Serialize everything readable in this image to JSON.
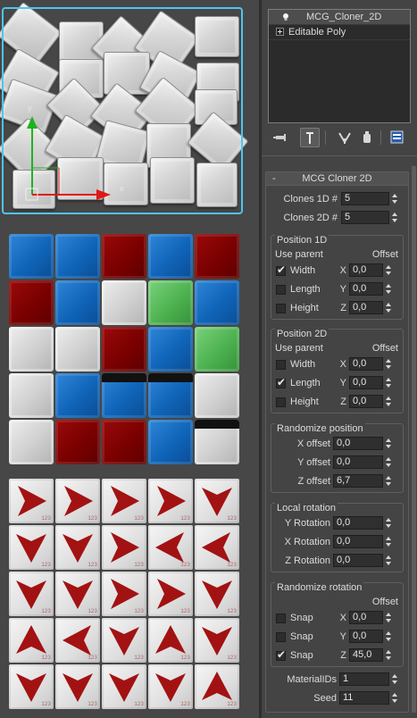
{
  "modifier_stack": {
    "items": [
      {
        "label": "MCG_Cloner_2D",
        "icon": "lightbulb-icon",
        "active": true
      },
      {
        "label": "Editable Poly",
        "icon": "expand-plus-icon",
        "active": false
      }
    ]
  },
  "stack_toolbar": {
    "buttons": [
      "pin-stack-icon",
      "show-end-result-icon",
      "make-unique-icon",
      "remove-modifier-icon",
      "configure-modifier-sets-icon"
    ]
  },
  "rollout": {
    "collapse_symbol": "-",
    "title": "MCG Cloner 2D",
    "clones_1d": {
      "label": "Clones 1D #",
      "value": "5"
    },
    "clones_2d": {
      "label": "Clones 2D #",
      "value": "5"
    },
    "position_1d": {
      "title": "Position 1D",
      "use_parent": "Use parent",
      "offset": "Offset",
      "rows": [
        {
          "label": "Width",
          "checked": true,
          "axis": "X",
          "value": "0,0"
        },
        {
          "label": "Length",
          "checked": false,
          "axis": "Y",
          "value": "0,0"
        },
        {
          "label": "Height",
          "checked": false,
          "axis": "Z",
          "value": "0,0"
        }
      ]
    },
    "position_2d": {
      "title": "Position 2D",
      "use_parent": "Use parent",
      "offset": "Offset",
      "rows": [
        {
          "label": "Width",
          "checked": false,
          "axis": "X",
          "value": "0,0"
        },
        {
          "label": "Length",
          "checked": true,
          "axis": "Y",
          "value": "0,0"
        },
        {
          "label": "Height",
          "checked": false,
          "axis": "Z",
          "value": "0,0"
        }
      ]
    },
    "randomize_position": {
      "title": "Randomize position",
      "rows": [
        {
          "label": "X offset",
          "value": "0,0"
        },
        {
          "label": "Y offset",
          "value": "0,0"
        },
        {
          "label": "Z offset",
          "value": "6,7"
        }
      ]
    },
    "local_rotation": {
      "title": "Local rotation",
      "rows": [
        {
          "label": "Y Rotation",
          "value": "0,0"
        },
        {
          "label": "X Rotation",
          "value": "0,0"
        },
        {
          "label": "Z Rotation",
          "value": "0,0"
        }
      ]
    },
    "randomize_rotation": {
      "title": "Randomize rotation",
      "offset": "Offset",
      "rows": [
        {
          "label": "Snap",
          "checked": false,
          "axis": "X",
          "value": "0,0"
        },
        {
          "label": "Snap",
          "checked": false,
          "axis": "Y",
          "value": "0,0"
        },
        {
          "label": "Snap",
          "checked": true,
          "axis": "Z",
          "value": "45,0"
        }
      ]
    },
    "material_ids": {
      "label": "MaterialIDs",
      "value": "1"
    },
    "seed": {
      "label": "Seed",
      "value": "11"
    }
  },
  "viewport": {
    "gizmo": {
      "x_label": "x",
      "y_label": "y",
      "x_color": "#e01818",
      "y_color": "#1fb21f",
      "z_color": "#1850e0"
    },
    "selection_color": "#4fc4f0",
    "arrow_tile_text": "123",
    "color_grid": [
      [
        "blue",
        "blue",
        "red",
        "blue",
        "red"
      ],
      [
        "red",
        "blue",
        "gray",
        "green",
        "blue"
      ],
      [
        "gray",
        "gray",
        "red",
        "blue",
        "green"
      ],
      [
        "gray",
        "blue",
        "blue-dark",
        "blue-dark",
        "gray"
      ],
      [
        "gray",
        "red",
        "red",
        "blue",
        "gray-dark"
      ]
    ],
    "arrow_grid": [
      [
        "right",
        "right",
        "right",
        "right",
        "down"
      ],
      [
        "down",
        "down",
        "right",
        "left",
        "left"
      ],
      [
        "down",
        "down",
        "right",
        "right",
        "down"
      ],
      [
        "up",
        "left",
        "down",
        "up",
        "down"
      ],
      [
        "down",
        "down",
        "down",
        "down",
        "up"
      ]
    ]
  }
}
